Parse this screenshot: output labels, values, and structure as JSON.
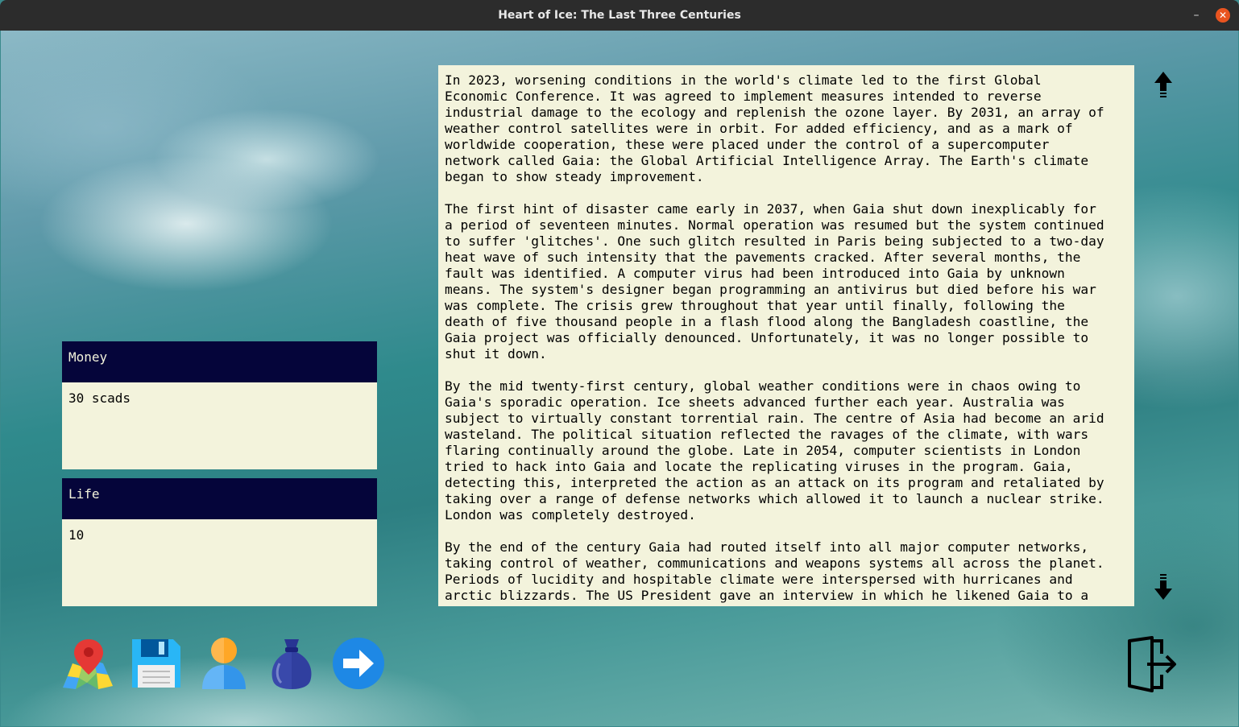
{
  "window": {
    "title": "Heart of Ice: The Last Three Centuries",
    "minimize": "–",
    "close": "✕"
  },
  "money": {
    "label": "Money",
    "value": "30 scads"
  },
  "life": {
    "label": "Life",
    "value": "10"
  },
  "story": {
    "paragraphs": [
      "In 2023, worsening conditions in the world's climate led to the first Global\nEconomic Conference. It was agreed to implement measures intended to reverse\nindustrial damage to the ecology and replenish the ozone layer. By 2031, an array of\nweather control satellites were in orbit. For added efficiency, and as a mark of\nworldwide cooperation, these were placed under the control of a supercomputer\nnetwork called Gaia: the Global Artificial Intelligence Array. The Earth's climate\nbegan to show steady improvement.",
      "The first hint of disaster came early in 2037, when Gaia shut down inexplicably for\na period of seventeen minutes. Normal operation was resumed but the system continued\nto suffer 'glitches'. One such glitch resulted in Paris being subjected to a two-day\nheat wave of such intensity that the pavements cracked. After several months, the\nfault was identified. A computer virus had been introduced into Gaia by unknown\nmeans. The system's designer began programming an antivirus but died before his war\nwas complete. The crisis grew throughout that year until finally, following the\ndeath of five thousand people in a flash flood along the Bangladesh coastline, the\nGaia project was officially denounced. Unfortunately, it was no longer possible to\nshut it down.",
      "By the mid twenty-first century, global weather conditions were in chaos owing to\nGaia's sporadic operation. Ice sheets advanced further each year. Australia was\nsubject to virtually constant torrential rain. The centre of Asia had become an arid\nwasteland. The political situation reflected the ravages of the climate, with wars\nflaring continually around the globe. Late in 2054, computer scientists in London\ntried to hack into Gaia and locate the replicating viruses in the program. Gaia,\ndetecting this, interpreted the action as an attack on its program and retaliated by\ntaking over a range of defense networks which allowed it to launch a nuclear strike.\nLondon was completely destroyed.",
      "By the end of the century Gaia had routed itself into all major computer networks,\ntaking control of weather, communications and weapons systems all across the planet.\nPeriods of lucidity and hospitable climate were interspersed with hurricanes and\narctic blizzards. The US President gave an interview in which he likened Gaia to a"
    ]
  },
  "toolbar": {
    "icons": [
      "map-icon",
      "save-icon",
      "character-icon",
      "items-bag-icon",
      "next-arrow-icon"
    ]
  },
  "colors": {
    "panel_header": "#05053a",
    "panel_body": "#f3f3dc",
    "titlebar": "#2c2c2c",
    "close": "#e95420",
    "arrow_blue": "#1e88e5"
  }
}
